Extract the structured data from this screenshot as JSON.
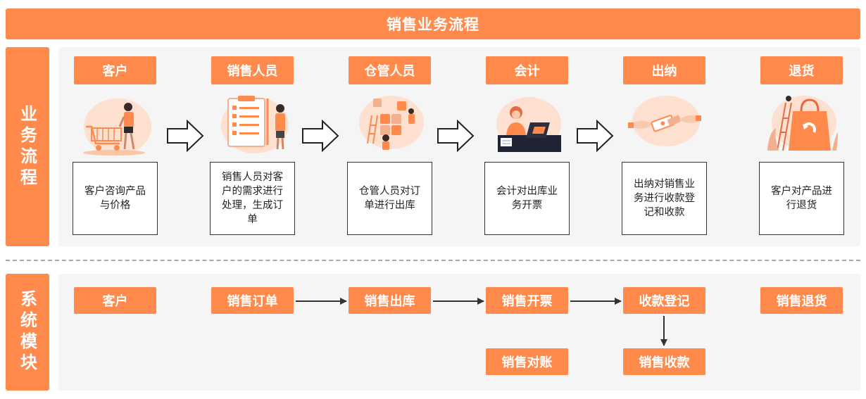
{
  "title": "销售业务流程",
  "side_labels": {
    "process": "业务流程",
    "modules": "系统模块"
  },
  "roles": [
    {
      "label": "客户",
      "desc": "客户咨询产品与价格",
      "icon": "customer-shopping-cart-icon"
    },
    {
      "label": "销售人员",
      "desc": "销售人员对客户的需求进行处理，生成订单",
      "icon": "sales-checklist-icon"
    },
    {
      "label": "仓管人员",
      "desc": "仓管人员对订单进行出库",
      "icon": "warehouse-puzzle-icon"
    },
    {
      "label": "会计",
      "desc": "会计对出库业务开票",
      "icon": "accountant-laptop-icon"
    },
    {
      "label": "出纳",
      "desc": "出纳对销售业务进行收款登记和收款",
      "icon": "cashier-payment-icon"
    },
    {
      "label": "退货",
      "desc": "客户对产品进行退货",
      "icon": "return-shopping-bag-icon"
    }
  ],
  "modules": {
    "customer": "客户",
    "sales_order": "销售订单",
    "sales_outbound": "销售出库",
    "sales_invoice": "销售开票",
    "payment_register": "收款登记",
    "sales_return": "销售退货",
    "sales_reconcile": "销售对账",
    "sales_receipt": "销售收款"
  },
  "colors": {
    "accent": "#ff8a4c",
    "panel": "#f5f5f5",
    "border": "#333333",
    "divider": "#a9a9a9"
  }
}
